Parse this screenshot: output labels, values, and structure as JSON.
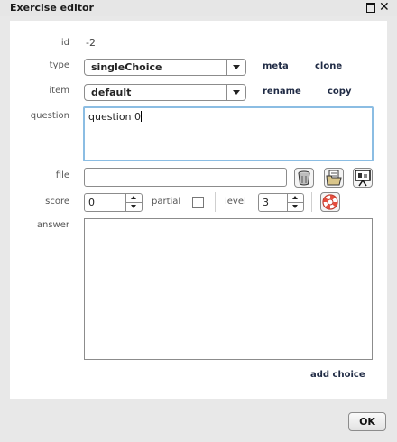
{
  "window": {
    "title": "Exercise editor",
    "maximize_icon": "maximize-icon",
    "close_icon": "close-icon",
    "close_glyph": "✕"
  },
  "form": {
    "id": {
      "label": "id",
      "value": "-2"
    },
    "type": {
      "label": "type",
      "selected": "singleChoice",
      "actions": [
        "meta",
        "clone"
      ]
    },
    "item": {
      "label": "item",
      "selected": "default",
      "actions": [
        "rename",
        "copy"
      ]
    },
    "question": {
      "label": "question",
      "value": "question 0"
    },
    "file": {
      "label": "file",
      "value": "",
      "icons": [
        "trash-icon",
        "folder-open-icon",
        "presentation-icon"
      ]
    },
    "score": {
      "label": "score",
      "value": "0"
    },
    "partial": {
      "label": "partial",
      "checked": false
    },
    "level": {
      "label": "level",
      "value": "3"
    },
    "help_icon": "lifebuoy-icon",
    "answer": {
      "label": "answer",
      "value": ""
    },
    "add_choice": "add choice"
  },
  "footer": {
    "ok_label": "OK"
  },
  "colors": {
    "focus_border": "#8bbde3",
    "panel_bg": "#ffffff",
    "window_bg": "#e8e8e8"
  }
}
